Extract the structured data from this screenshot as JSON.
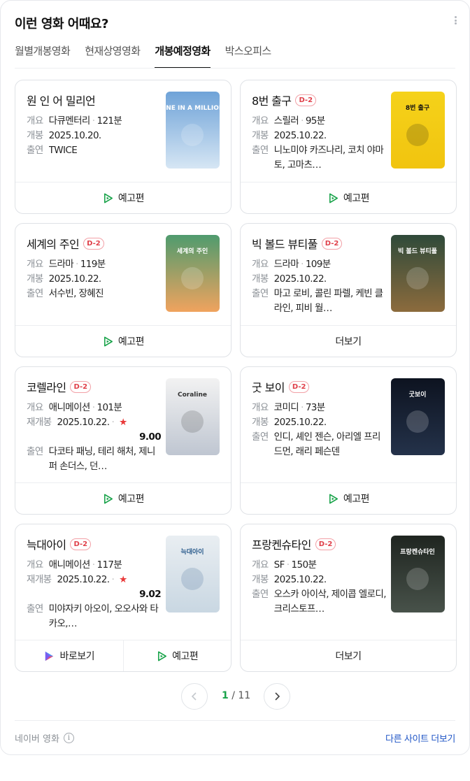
{
  "header": {
    "title": "이런 영화 어때요?"
  },
  "tabs": [
    "월별개봉영화",
    "현재상영영화",
    "개봉예정영화",
    "박스오피스"
  ],
  "labels": {
    "genre": "개요",
    "release": "개봉",
    "rerelease": "재개봉",
    "cast": "출연"
  },
  "movies": [
    {
      "title": "원 인 어 밀리언",
      "badge": "",
      "genre": "다큐멘터리",
      "runtime": "121분",
      "date_label": "개봉",
      "date": "2025.10.20.",
      "rating": "",
      "cast": "TWICE",
      "buttons": [
        "예고편"
      ]
    },
    {
      "title": "8번 출구",
      "badge": "D-2",
      "genre": "스릴러",
      "runtime": "95분",
      "date_label": "개봉",
      "date": "2025.10.22.",
      "rating": "",
      "cast": "니노미야 카즈나리, 코치 야마토, 고마츠…",
      "buttons": [
        "예고편"
      ]
    },
    {
      "title": "세계의 주인",
      "badge": "D-2",
      "genre": "드라마",
      "runtime": "119분",
      "date_label": "개봉",
      "date": "2025.10.22.",
      "rating": "",
      "cast": "서수빈, 장혜진",
      "buttons": [
        "예고편"
      ]
    },
    {
      "title": "빅 볼드 뷰티풀",
      "badge": "D-2",
      "genre": "드라마",
      "runtime": "109분",
      "date_label": "개봉",
      "date": "2025.10.22.",
      "rating": "",
      "cast": "마고 로비, 콜린 파렐, 케빈 클라인, 피비 월…",
      "buttons": [
        "더보기"
      ]
    },
    {
      "title": "코렐라인",
      "badge": "D-2",
      "genre": "애니메이션",
      "runtime": "101분",
      "date_label": "재개봉",
      "date": "2025.10.22.",
      "rating": "9.00",
      "cast": "다코타 패닝, 테리 해처, 제니퍼 손더스, 던…",
      "buttons": [
        "예고편"
      ]
    },
    {
      "title": "굿 보이",
      "badge": "D-2",
      "genre": "코미디",
      "runtime": "73분",
      "date_label": "개봉",
      "date": "2025.10.22.",
      "rating": "",
      "cast": "인디, 셰인 젠슨, 아리엘 프리드먼, 래리 페슨덴",
      "buttons": [
        "예고편"
      ]
    },
    {
      "title": "늑대아이",
      "badge": "D-2",
      "genre": "애니메이션",
      "runtime": "117분",
      "date_label": "재개봉",
      "date": "2025.10.22.",
      "rating": "9.02",
      "cast": "미야자키 아오이, 오오사와 타카오,…",
      "buttons": [
        "바로보기",
        "예고편"
      ]
    },
    {
      "title": "프랑켄슈타인",
      "badge": "D-2",
      "genre": "SF",
      "runtime": "150분",
      "date_label": "개봉",
      "date": "2025.10.22.",
      "rating": "",
      "cast": "오스카 아이삭, 제이콥 엘로디, 크리스토프…",
      "buttons": [
        "더보기"
      ]
    }
  ],
  "posters": [
    {
      "text": "ONE IN A MILLION",
      "colors": [
        "#6fa3d8",
        "#d6e6f4"
      ],
      "accent": "#ffffff"
    },
    {
      "text": "8번 출구",
      "colors": [
        "#f5d21a",
        "#f1c40f"
      ],
      "accent": "#111111"
    },
    {
      "text": "세계의 주인",
      "colors": [
        "#4f9b6e",
        "#f0a35e"
      ],
      "accent": "#ffffff"
    },
    {
      "text": "빅 볼드 뷰티풀",
      "colors": [
        "#2f4a3a",
        "#8c6b3d"
      ],
      "accent": "#ffffff"
    },
    {
      "text": "Coraline",
      "colors": [
        "#f2f2f2",
        "#bfc6d1"
      ],
      "accent": "#333333"
    },
    {
      "text": "굿보이",
      "colors": [
        "#0d1320",
        "#24324a"
      ],
      "accent": "#ffffff"
    },
    {
      "text": "늑대아이",
      "colors": [
        "#e9eef2",
        "#c9d7e2"
      ],
      "accent": "#2a5b8c"
    },
    {
      "text": "프랑켄슈타인",
      "colors": [
        "#1f2520",
        "#48524a"
      ],
      "accent": "#ffffff"
    }
  ],
  "pagination": {
    "current": "1",
    "total": "/ 11"
  },
  "footer": {
    "source": "네이버 영화",
    "more_sites": "다른 사이트 더보기"
  },
  "colors": {
    "accent_green": "#19a34a",
    "badge_red": "#e0404a",
    "link_blue": "#1f55c6"
  }
}
